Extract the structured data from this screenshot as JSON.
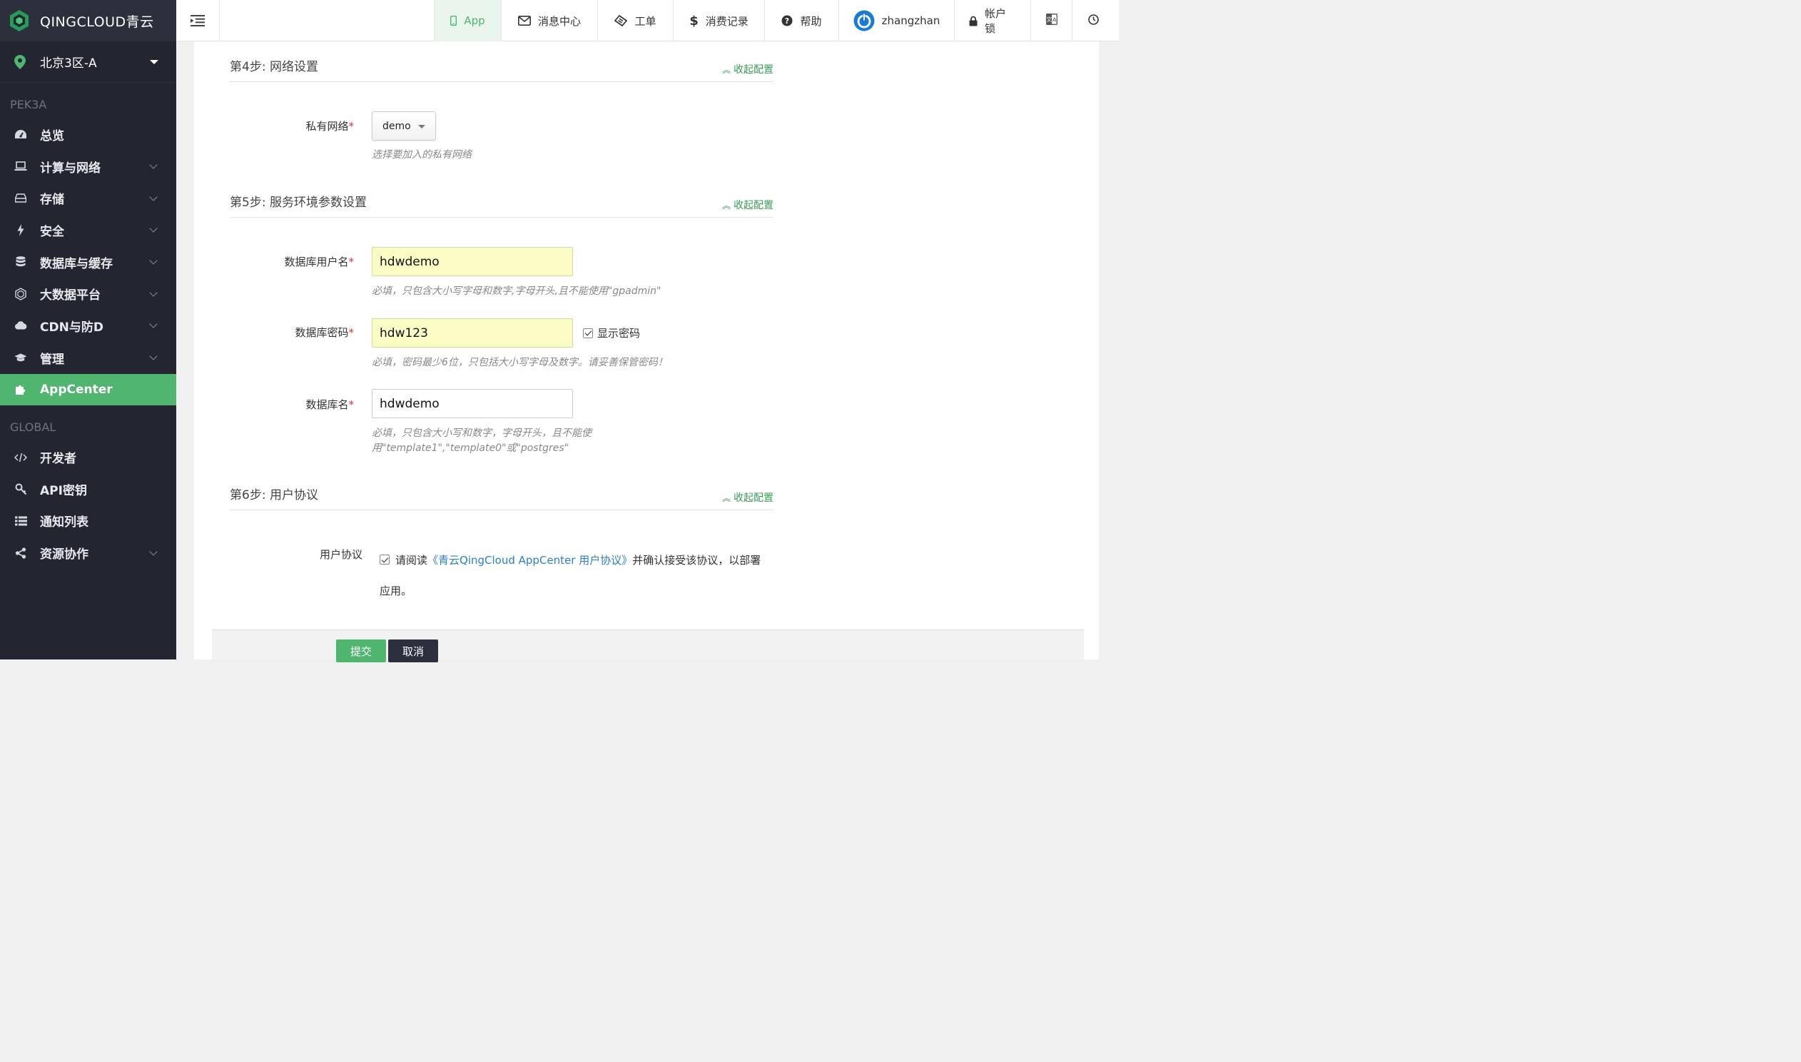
{
  "sidebar": {
    "brand": "QINGCLOUD青云",
    "region": "北京3区-A",
    "zone_label": "PEK3A",
    "items": [
      {
        "label": "总览",
        "icon": "dashboard-icon",
        "expandable": false
      },
      {
        "label": "计算与网络",
        "icon": "laptop-icon",
        "expandable": true
      },
      {
        "label": "存储",
        "icon": "hdd-icon",
        "expandable": true
      },
      {
        "label": "安全",
        "icon": "bolt-icon",
        "expandable": true
      },
      {
        "label": "数据库与缓存",
        "icon": "database-icon",
        "expandable": true
      },
      {
        "label": "大数据平台",
        "icon": "hexagon-icon",
        "expandable": true
      },
      {
        "label": "CDN与防D",
        "icon": "cloud-icon",
        "expandable": true
      },
      {
        "label": "管理",
        "icon": "graduation-cap-icon",
        "expandable": true
      },
      {
        "label": "AppCenter",
        "icon": "puzzle-icon",
        "expandable": false,
        "active": true
      }
    ],
    "global_label": "GLOBAL",
    "global_items": [
      {
        "label": "开发者",
        "icon": "code-icon",
        "expandable": false
      },
      {
        "label": "API密钥",
        "icon": "key-icon",
        "expandable": false
      },
      {
        "label": "通知列表",
        "icon": "list-icon",
        "expandable": false
      },
      {
        "label": "资源协作",
        "icon": "share-icon",
        "expandable": true
      }
    ]
  },
  "topbar": {
    "app": "App",
    "messages": "消息中心",
    "tickets": "工单",
    "billing": "消费记录",
    "help": "帮助",
    "user": "zhangzhan",
    "lock": "帐户锁"
  },
  "form": {
    "collapse_label": "收起配置",
    "step4": {
      "title": "第4步: 网络设置",
      "vpc_label": "私有网络",
      "vpc_value": "demo",
      "vpc_hint": "选择要加入的私有网络"
    },
    "step5": {
      "title": "第5步: 服务环境参数设置",
      "db_user_label": "数据库用户名",
      "db_user_value": "hdwdemo",
      "db_user_hint": "必填，只包含大小写字母和数字,字母开头,且不能使用\"gpadmin\"",
      "db_pass_label": "数据库密码",
      "db_pass_value": "hdw123",
      "show_password": "显示密码",
      "db_pass_hint": "必填，密码最少6位，只包括大小写字母及数字。请妥善保管密码！",
      "db_name_label": "数据库名",
      "db_name_value": "hdwdemo",
      "db_name_hint_1": "必填，只包含大小写和数字，字母开头，且不能使",
      "db_name_hint_2": "用\"template1\",\"template0\"或\"postgres\""
    },
    "step6": {
      "title": "第6步: 用户协议",
      "agreement_label": "用户协议",
      "agree_prefix": "请阅读",
      "agree_link": "《青云QingCloud AppCenter 用户协议》",
      "agree_suffix": "并确认接受该协议，以部署应用。"
    },
    "submit": "提交",
    "cancel": "取消"
  },
  "colors": {
    "accent": "#4fb56f",
    "sidebar_bg": "#232631",
    "link": "#2d7fc5",
    "filled_input": "#fafcc4"
  }
}
